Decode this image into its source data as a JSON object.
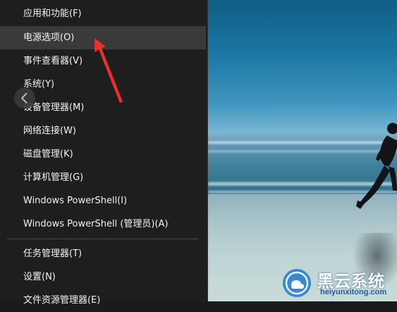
{
  "menu": {
    "items": [
      {
        "label": "应用和功能(F)"
      },
      {
        "label": "电源选项(O)"
      },
      {
        "label": "事件查看器(V)"
      },
      {
        "label": "系统(Y)"
      },
      {
        "label": "设备管理器(M)"
      },
      {
        "label": "网络连接(W)"
      },
      {
        "label": "磁盘管理(K)"
      },
      {
        "label": "计算机管理(G)"
      },
      {
        "label": "Windows PowerShell(I)"
      },
      {
        "label": "Windows PowerShell (管理员)(A)"
      },
      {
        "label": "任务管理器(T)"
      },
      {
        "label": "设置(N)"
      },
      {
        "label": "文件资源管理器(E)"
      }
    ],
    "highlighted_item": "电源选项(O)"
  },
  "watermark": {
    "brand": "黑云系统",
    "url": "heiyunxitong.com"
  },
  "colors": {
    "menu_bg": "#1e1e1e",
    "menu_hover": "#3a3a3a",
    "menu_text": "#f2f2f2",
    "annotation_arrow": "#e8302a",
    "watermark_accent": "#1f5f9a"
  },
  "icons": {
    "back": "chevron-left-icon",
    "annotation": "red-arrow-annotation",
    "watermark_logo": "cloud-logo-icon"
  }
}
